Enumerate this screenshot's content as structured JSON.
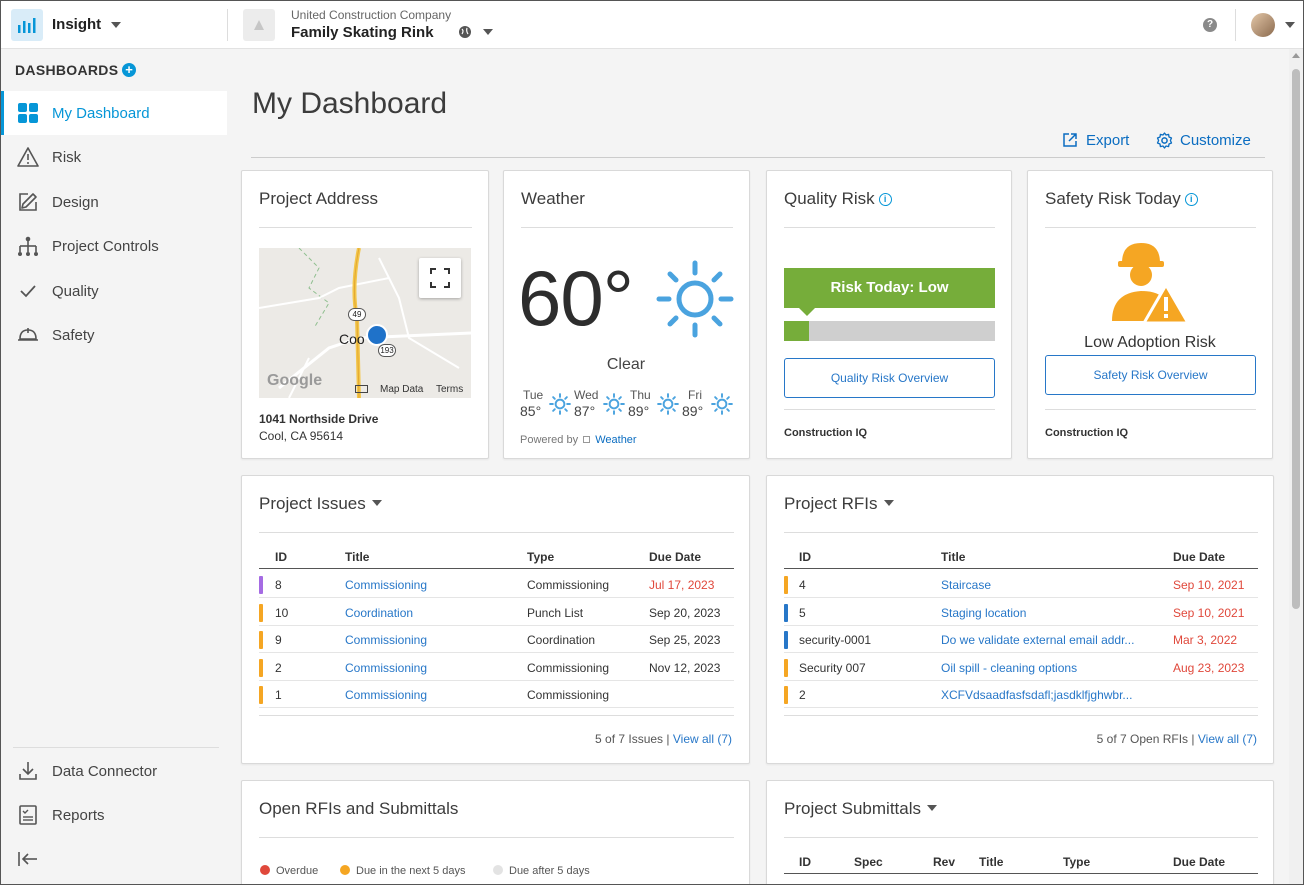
{
  "app": {
    "name": "Insight",
    "icon": "bar-chart-icon"
  },
  "project": {
    "company": "United Construction Company",
    "name": "Family Skating Rink"
  },
  "sidebar": {
    "heading": "DASHBOARDS",
    "add_label": "+",
    "items": [
      {
        "label": "My Dashboard",
        "icon": "grid-icon",
        "active": true
      },
      {
        "label": "Risk",
        "icon": "warning-icon"
      },
      {
        "label": "Design",
        "icon": "edit-icon"
      },
      {
        "label": "Project Controls",
        "icon": "hierarchy-icon"
      },
      {
        "label": "Quality",
        "icon": "check-icon"
      },
      {
        "label": "Safety",
        "icon": "hardhat-icon"
      }
    ],
    "bottom_items": [
      {
        "label": "Data Connector",
        "icon": "download-icon"
      },
      {
        "label": "Reports",
        "icon": "report-icon"
      }
    ]
  },
  "page": {
    "title": "My Dashboard",
    "export_label": "Export",
    "customize_label": "Customize"
  },
  "address_card": {
    "title": "Project Address",
    "map": {
      "town": "Coo",
      "route_a": "49",
      "route_b": "193",
      "google": "Google",
      "map_data": "Map Data",
      "terms": "Terms"
    },
    "line1": "1041 Northside Drive",
    "line2": "Cool, CA 95614"
  },
  "weather_card": {
    "title": "Weather",
    "temperature": "60°",
    "condition": "Clear",
    "forecast": [
      {
        "day": "Tue",
        "temp": "85°"
      },
      {
        "day": "Wed",
        "temp": "87°"
      },
      {
        "day": "Thu",
        "temp": "89°"
      },
      {
        "day": "Fri",
        "temp": "89°"
      }
    ],
    "powered_prefix": "Powered by",
    "powered_link": "Weather"
  },
  "quality_card": {
    "title": "Quality Risk",
    "banner": "Risk Today: Low",
    "level": 0.12,
    "button": "Quality Risk Overview",
    "footer": "Construction IQ"
  },
  "safety_card": {
    "title": "Safety Risk Today",
    "status": "Low Adoption Risk",
    "button": "Safety Risk Overview",
    "footer": "Construction IQ"
  },
  "issues_card": {
    "title": "Project Issues",
    "headers": {
      "id": "ID",
      "title": "Title",
      "type": "Type",
      "due": "Due Date"
    },
    "rows": [
      {
        "id": "8",
        "title": "Commissioning",
        "type": "Commissioning",
        "due": "Jul 17, 2023",
        "color": "#a56be3",
        "late": true
      },
      {
        "id": "10",
        "title": "Coordination",
        "type": "Punch List",
        "due": "Sep 20, 2023",
        "color": "#f5a623",
        "late": false
      },
      {
        "id": "9",
        "title": "Commissioning",
        "type": "Coordination",
        "due": "Sep 25, 2023",
        "color": "#f5a623",
        "late": false
      },
      {
        "id": "2",
        "title": "Commissioning",
        "type": "Commissioning",
        "due": "Nov 12, 2023",
        "color": "#f5a623",
        "late": false
      },
      {
        "id": "1",
        "title": "Commissioning",
        "type": "Commissioning",
        "due": "",
        "color": "#f5a623",
        "late": false
      }
    ],
    "count_text": "5 of 7 Issues",
    "view_all": "View all (7)"
  },
  "rfis_card": {
    "title": "Project RFIs",
    "headers": {
      "id": "ID",
      "title": "Title",
      "due": "Due Date"
    },
    "rows": [
      {
        "id": "4",
        "title": "Staircase",
        "due": "Sep 10, 2021",
        "color": "#f5a623"
      },
      {
        "id": "5",
        "title": "Staging location",
        "due": "Sep 10, 2021",
        "color": "#2777c8"
      },
      {
        "id": "security-0001",
        "title": "Do we validate external email addr...",
        "due": "Mar 3, 2022",
        "color": "#2777c8"
      },
      {
        "id": "Security 007",
        "title": "Oil spill - cleaning options",
        "due": "Aug 23, 2023",
        "color": "#f5a623"
      },
      {
        "id": "2",
        "title": "XCFVdsaadfasfsdafl;jasdklfjghwbr...",
        "due": "",
        "color": "#f5a623"
      }
    ],
    "count_text": "5 of 7 Open RFIs",
    "view_all": "View all (7)"
  },
  "open_card": {
    "title": "Open RFIs and Submittals",
    "legend": [
      {
        "label": "Overdue",
        "color": "#e0483b"
      },
      {
        "label": "Due in the next 5 days",
        "color": "#f5a623"
      },
      {
        "label": "Due after 5 days",
        "color": "#e3e3e3"
      }
    ]
  },
  "submittals_card": {
    "title": "Project Submittals",
    "headers": {
      "id": "ID",
      "spec": "Spec",
      "rev": "Rev",
      "title": "Title",
      "type": "Type",
      "due": "Due Date"
    }
  }
}
